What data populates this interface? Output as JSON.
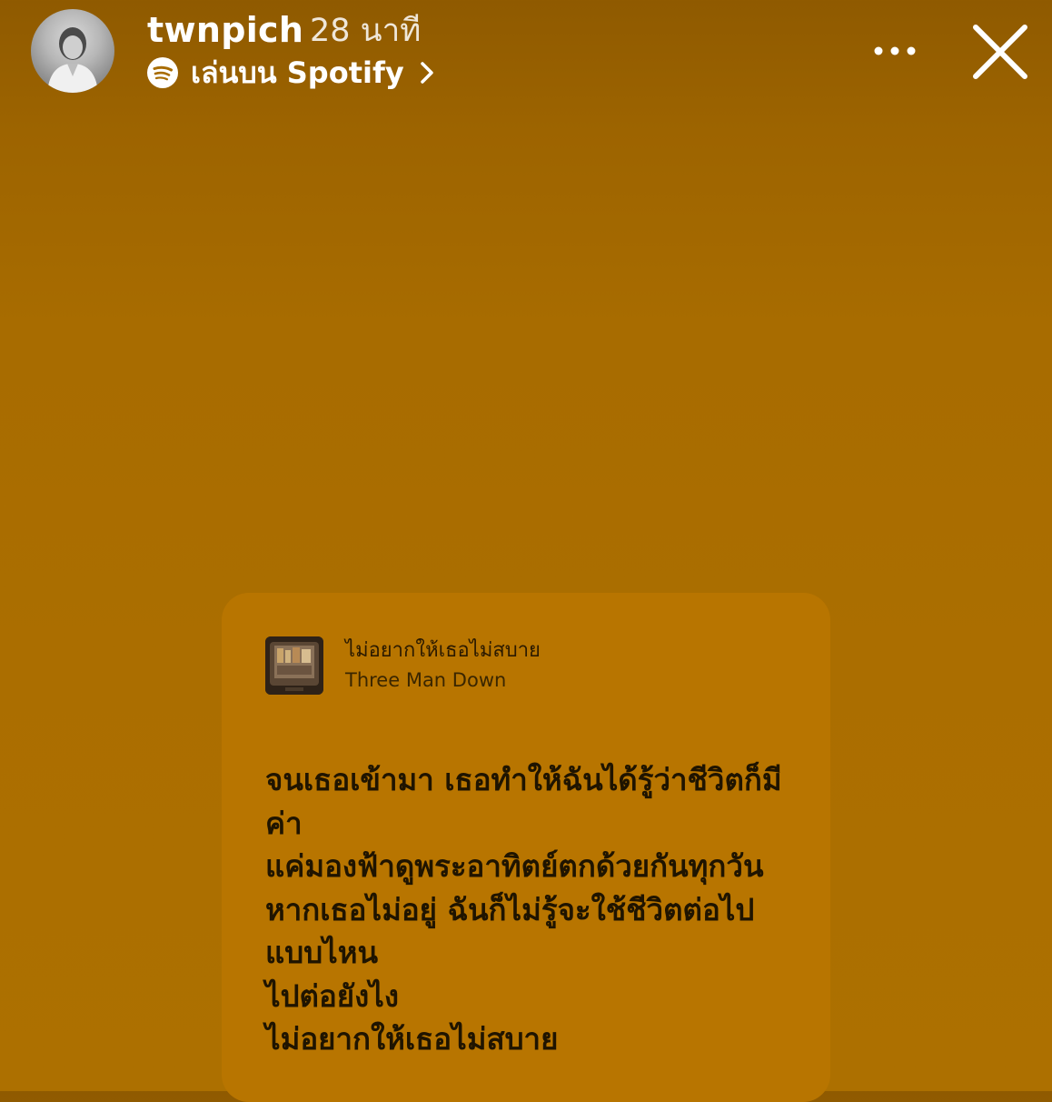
{
  "header": {
    "username": "twnpich",
    "time_ago": "28 นาที",
    "spotify_label": "เล่นบน Spotify",
    "spotify_icon": "spotify-icon",
    "chevron_icon": "chevron-right-icon",
    "more_icon": "more-options-icon",
    "close_icon": "close-icon"
  },
  "card": {
    "song_title": "ไม่อยากให้เธอไม่สบาย",
    "artist": "Three Man Down",
    "lyrics": [
      "จนเธอเข้ามา เธอทำให้ฉันได้รู้ว่าชีวิตก็มี",
      "ค่า",
      "แค่มองฟ้าดูพระอาทิตย์ตกด้วยกันทุกวัน",
      "หากเธอไม่อยู่ ฉันก็ไม่รู้จะใช้ชีวิตต่อไป",
      "แบบไหน",
      "ไปต่อยังไง",
      "ไม่อยากให้เธอไม่สบาย"
    ]
  },
  "colors": {
    "background": "#a86c00",
    "card": "#b87500",
    "text_light": "#ffffff",
    "text_dark": "#1f1400"
  }
}
